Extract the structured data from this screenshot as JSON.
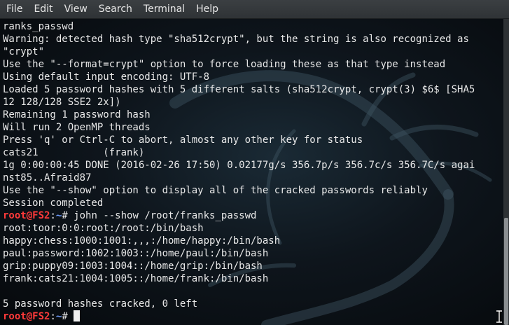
{
  "menubar": {
    "items": [
      "File",
      "Edit",
      "View",
      "Search",
      "Terminal",
      "Help"
    ]
  },
  "terminal": {
    "output_lines": [
      "ranks_passwd",
      "Warning: detected hash type \"sha512crypt\", but the string is also recognized as",
      "\"crypt\"",
      "Use the \"--format=crypt\" option to force loading these as that type instead",
      "Using default input encoding: UTF-8",
      "Loaded 5 password hashes with 5 different salts (sha512crypt, crypt(3) $6$ [SHA5",
      "12 128/128 SSE2 2x])",
      "Remaining 1 password hash",
      "Will run 2 OpenMP threads",
      "Press 'q' or Ctrl-C to abort, almost any other key for status",
      "cats21           (frank)",
      "1g 0:00:00:45 DONE (2016-02-26 17:50) 0.02177g/s 356.7p/s 356.7c/s 356.7C/s agai",
      "nst85..Afraid87",
      "Use the \"--show\" option to display all of the cracked passwords reliably",
      "Session completed"
    ],
    "prompt": {
      "user_host": "root@FS2",
      "separator": ":",
      "path": "~",
      "symbol": "# "
    },
    "show_command": "john --show /root/franks_passwd",
    "show_output": [
      "root:toor:0:0:root:/root:/bin/bash",
      "happy:chess:1000:1001:,,,:/home/happy:/bin/bash",
      "paul:password:1002:1003::/home/paul:/bin/bash",
      "grip:puppy09:1003:1004::/home/grip:/bin/bash",
      "frank:cats21:1004:1005::/home/frank:/bin/bash",
      "",
      "5 password hashes cracked, 0 left"
    ]
  },
  "theme": {
    "prompt_user_color": "#ff3a3a",
    "prompt_path_color": "#6f9dff",
    "text_color": "#e8e8e8"
  },
  "scrollbar": {
    "position_fraction": 1.0,
    "visible_fraction": 0.35
  }
}
